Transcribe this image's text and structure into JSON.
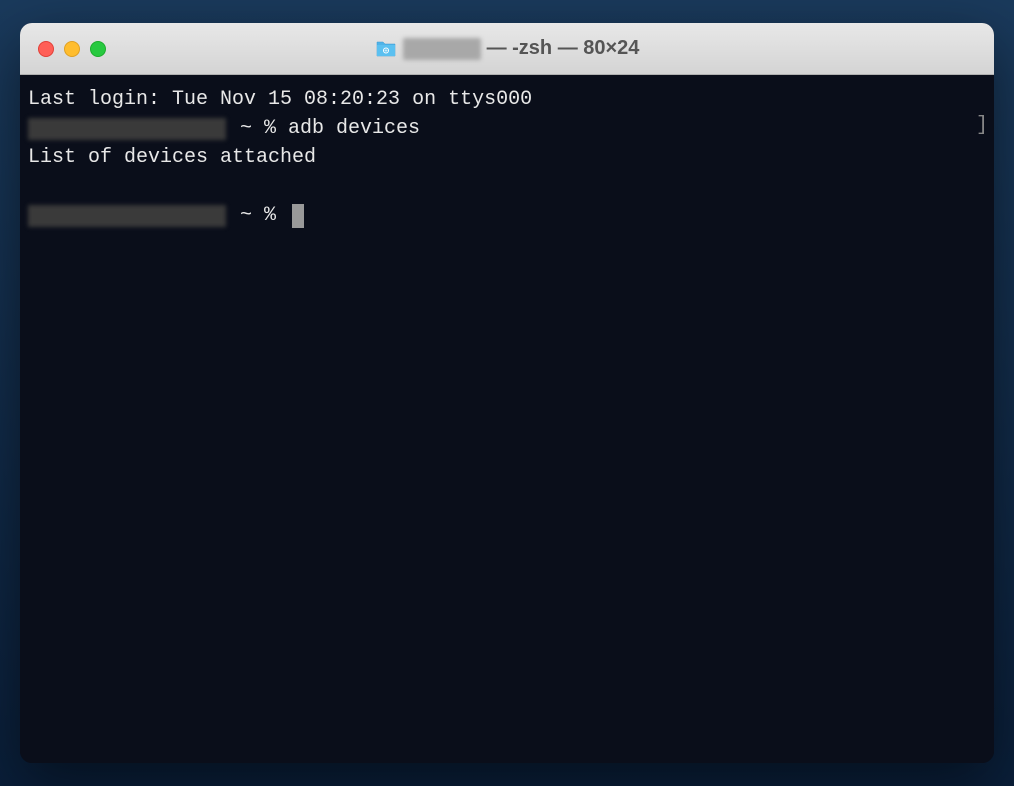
{
  "titlebar": {
    "title_suffix": " — -zsh — 80×24"
  },
  "terminal": {
    "last_login": "Last login: Tue Nov 15 08:20:23 on ttys000",
    "prompt_suffix_1": " ~ % ",
    "command_1": "adb devices",
    "output_1": "List of devices attached",
    "prompt_suffix_2": " ~ % ",
    "scroll_char": "]"
  }
}
